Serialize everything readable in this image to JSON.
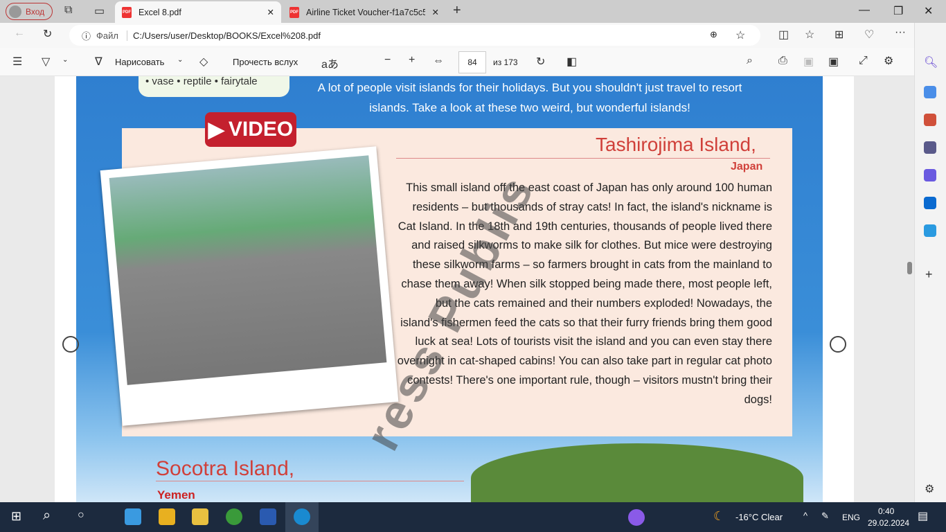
{
  "browser": {
    "profile_label": "Вход",
    "tabs": [
      {
        "title": "Excel 8.pdf",
        "active": true
      },
      {
        "title": "Airline Ticket Voucher-f1a7c5c58",
        "active": false
      }
    ],
    "address_prefix": "Файл",
    "url": "C:/Users/user/Desktop/BOOKS/Excel%208.pdf"
  },
  "pdf_toolbar": {
    "draw_label": "Нарисовать",
    "read_aloud_label": "Прочесть вслух",
    "page_current": "84",
    "page_total": "из 173"
  },
  "page": {
    "vocab": "• vase  • reptile  • fairytale",
    "intro": "A lot of people visit islands for their holidays. But you shouldn't just travel to resort islands. Take a look at these two weird, but wonderful islands!",
    "video_label": "VIDEO",
    "island1_title": "Tashirojima Island,",
    "island1_country": "Japan",
    "island1_body": "This small island off the east coast of Japan has only around 100 human residents – but thousands of stray cats! In fact, the island's nickname is Cat Island. In the 18th and 19th centuries, thousands of people lived there and raised silkworms to make silk for clothes. But mice were destroying these silkworm farms – so farmers brought in cats from the mainland to chase them away! When silk stopped being made there, most people left, but the cats remained and their numbers exploded! Nowadays, the island's fishermen feed the cats so that their furry friends bring them good luck at sea! Lots of tourists visit the island and you can even stay there overnight in cat-shaped cabins! You can also take part in regular cat photo contests! There's one important rule, though – visitors mustn't bring their dogs!",
    "island2_title": "Socotra Island,",
    "island2_country": "Yemen",
    "watermark": "ress Publis"
  },
  "taskbar": {
    "weather": "-16°C  Clear",
    "lang": "ENG",
    "time": "0:40",
    "date": "29.02.2024"
  }
}
